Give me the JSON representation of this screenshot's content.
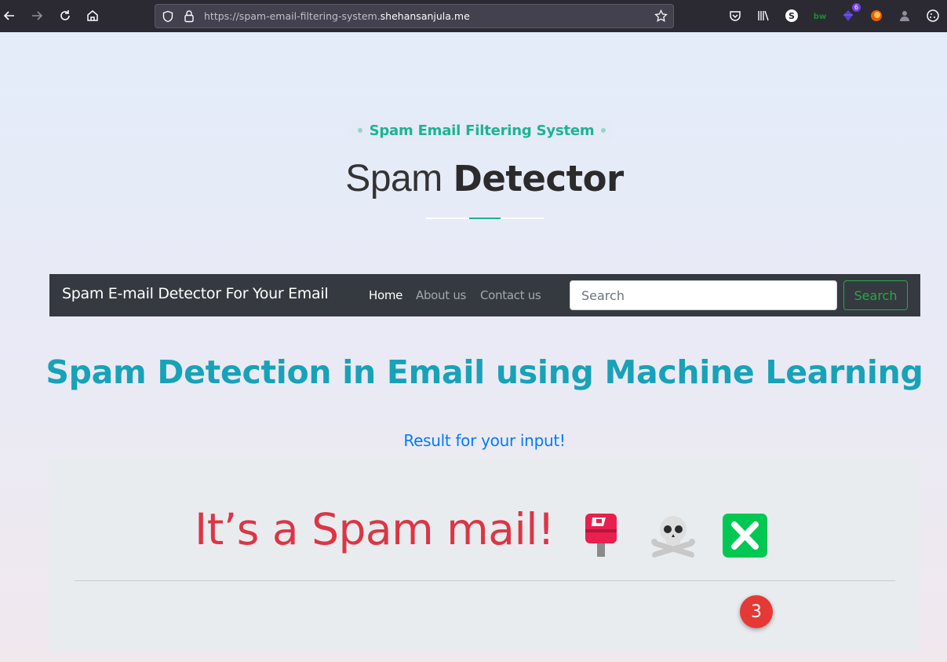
{
  "browser": {
    "url_prefix": "https://spam-email-filtering-system.",
    "url_domain": "shehansanjula.me",
    "extension_badge": "6"
  },
  "hero": {
    "tagline": "Spam Email Filtering System",
    "title_light": "Spam",
    "title_bold": "Detector"
  },
  "navbar": {
    "brand": "Spam E-mail Detector For Your Email",
    "links": [
      "Home",
      "About us",
      "Contact us"
    ],
    "active_link": "Home",
    "search_placeholder": "Search",
    "search_button": "Search"
  },
  "main": {
    "title": "Spam Detection in Email using Machine Learning",
    "result_label": "Result for your input!",
    "verdict": "It’s a Spam mail!",
    "verdict_emojis": [
      "postbox-icon",
      "skull-crossbones-icon",
      "cross-mark-icon"
    ]
  },
  "notification_count": "3",
  "colors": {
    "accent_teal": "#1cb394",
    "title_cyan": "#17a2b8",
    "link_blue": "#007bff",
    "danger_red": "#dc3545",
    "success_green": "#28a745",
    "navbar_dark": "#343a40"
  }
}
